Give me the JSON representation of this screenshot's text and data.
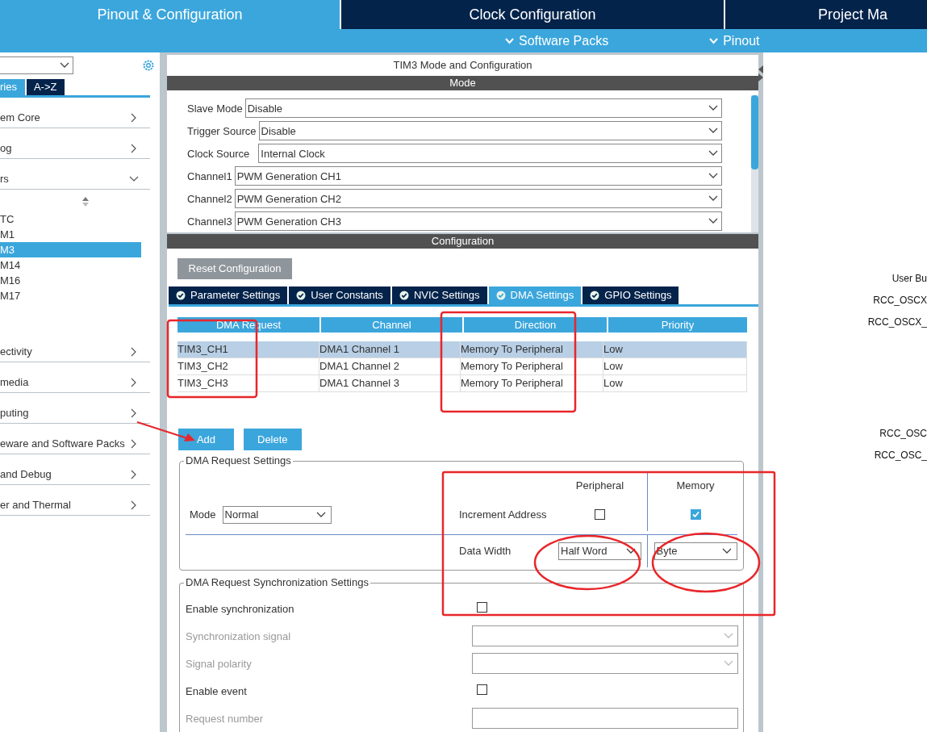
{
  "top_tabs": [
    {
      "label": "Pinout & Configuration",
      "selected": true
    },
    {
      "label": "Clock Configuration",
      "selected": false
    },
    {
      "label": "Project Ma",
      "selected": false
    }
  ],
  "sub_menu": [
    "Software Packs",
    "Pinout"
  ],
  "sidebar": {
    "tabs": [
      {
        "label": "ries",
        "selected": true
      },
      {
        "label": "A->Z",
        "selected": false
      }
    ],
    "categories": [
      {
        "label": "em Core",
        "expanded": false
      },
      {
        "label": "og",
        "expanded": false
      },
      {
        "label": "rs",
        "expanded": true,
        "children": [
          {
            "label": "TC",
            "selected": false
          },
          {
            "label": "M1",
            "selected": false
          },
          {
            "label": "M3",
            "selected": true
          },
          {
            "label": "M14",
            "selected": false
          },
          {
            "label": "M16",
            "selected": false
          },
          {
            "label": "M17",
            "selected": false
          }
        ]
      },
      {
        "label": "ectivity",
        "expanded": false
      },
      {
        "label": "media",
        "expanded": false
      },
      {
        "label": "puting",
        "expanded": false
      },
      {
        "label": "eware and Software Packs",
        "expanded": false
      },
      {
        "label": "and Debug",
        "expanded": false
      },
      {
        "label": "er and Thermal",
        "expanded": false
      }
    ]
  },
  "panel": {
    "title": "TIM3 Mode and Configuration",
    "mode_header": "Mode",
    "mode_fields": [
      {
        "label": "Slave Mode",
        "value": "Disable"
      },
      {
        "label": "Trigger Source",
        "value": "Disable"
      },
      {
        "label": "Clock Source",
        "value": "Internal Clock"
      },
      {
        "label": "Channel1",
        "value": "PWM Generation CH1"
      },
      {
        "label": "Channel2",
        "value": "PWM Generation CH2"
      },
      {
        "label": "Channel3",
        "value": "PWM Generation CH3"
      }
    ],
    "config_header": "Configuration",
    "reset_button": "Reset Configuration",
    "config_tabs": [
      {
        "label": "Parameter Settings",
        "selected": false
      },
      {
        "label": "User Constants",
        "selected": false
      },
      {
        "label": "NVIC Settings",
        "selected": false
      },
      {
        "label": "DMA Settings",
        "selected": true
      },
      {
        "label": "GPIO Settings",
        "selected": false
      }
    ],
    "dma_table": {
      "columns": [
        "DMA Request",
        "Channel",
        "Direction",
        "Priority"
      ],
      "rows": [
        {
          "cells": [
            "TIM3_CH1",
            "DMA1 Channel 1",
            "Memory To Peripheral",
            "Low"
          ],
          "selected": true
        },
        {
          "cells": [
            "TIM3_CH2",
            "DMA1 Channel 2",
            "Memory To Peripheral",
            "Low"
          ],
          "selected": false
        },
        {
          "cells": [
            "TIM3_CH3",
            "DMA1 Channel 3",
            "Memory To Peripheral",
            "Low"
          ],
          "selected": false
        }
      ]
    },
    "buttons": [
      "Add",
      "Delete"
    ],
    "request_settings": {
      "legend": "DMA Request Settings",
      "mode_label": "Mode",
      "mode_value": "Normal",
      "peripheral_header": "Peripheral",
      "memory_header": "Memory",
      "increment_label": "Increment Address",
      "increment_peripheral": false,
      "increment_memory": true,
      "width_label": "Data Width",
      "width_peripheral": "Half Word",
      "width_memory": "Byte"
    },
    "sync_settings": {
      "legend": "DMA Request Synchronization Settings",
      "rows": [
        {
          "kind": "checkbox",
          "label": "Enable synchronization",
          "disabled": false,
          "checked": false
        },
        {
          "kind": "select",
          "label": "Synchronization signal",
          "disabled": true
        },
        {
          "kind": "select",
          "label": "Signal polarity",
          "disabled": true
        },
        {
          "kind": "checkbox",
          "label": "Enable event",
          "disabled": false,
          "checked": false
        },
        {
          "kind": "input",
          "label": "Request number",
          "disabled": true
        }
      ]
    }
  },
  "pin_label_groups": [
    [
      "User Bu",
      "RCC_OSCX",
      "RCC_OSCX_"
    ],
    [
      "RCC_OSC",
      "RCC_OSC_"
    ]
  ]
}
